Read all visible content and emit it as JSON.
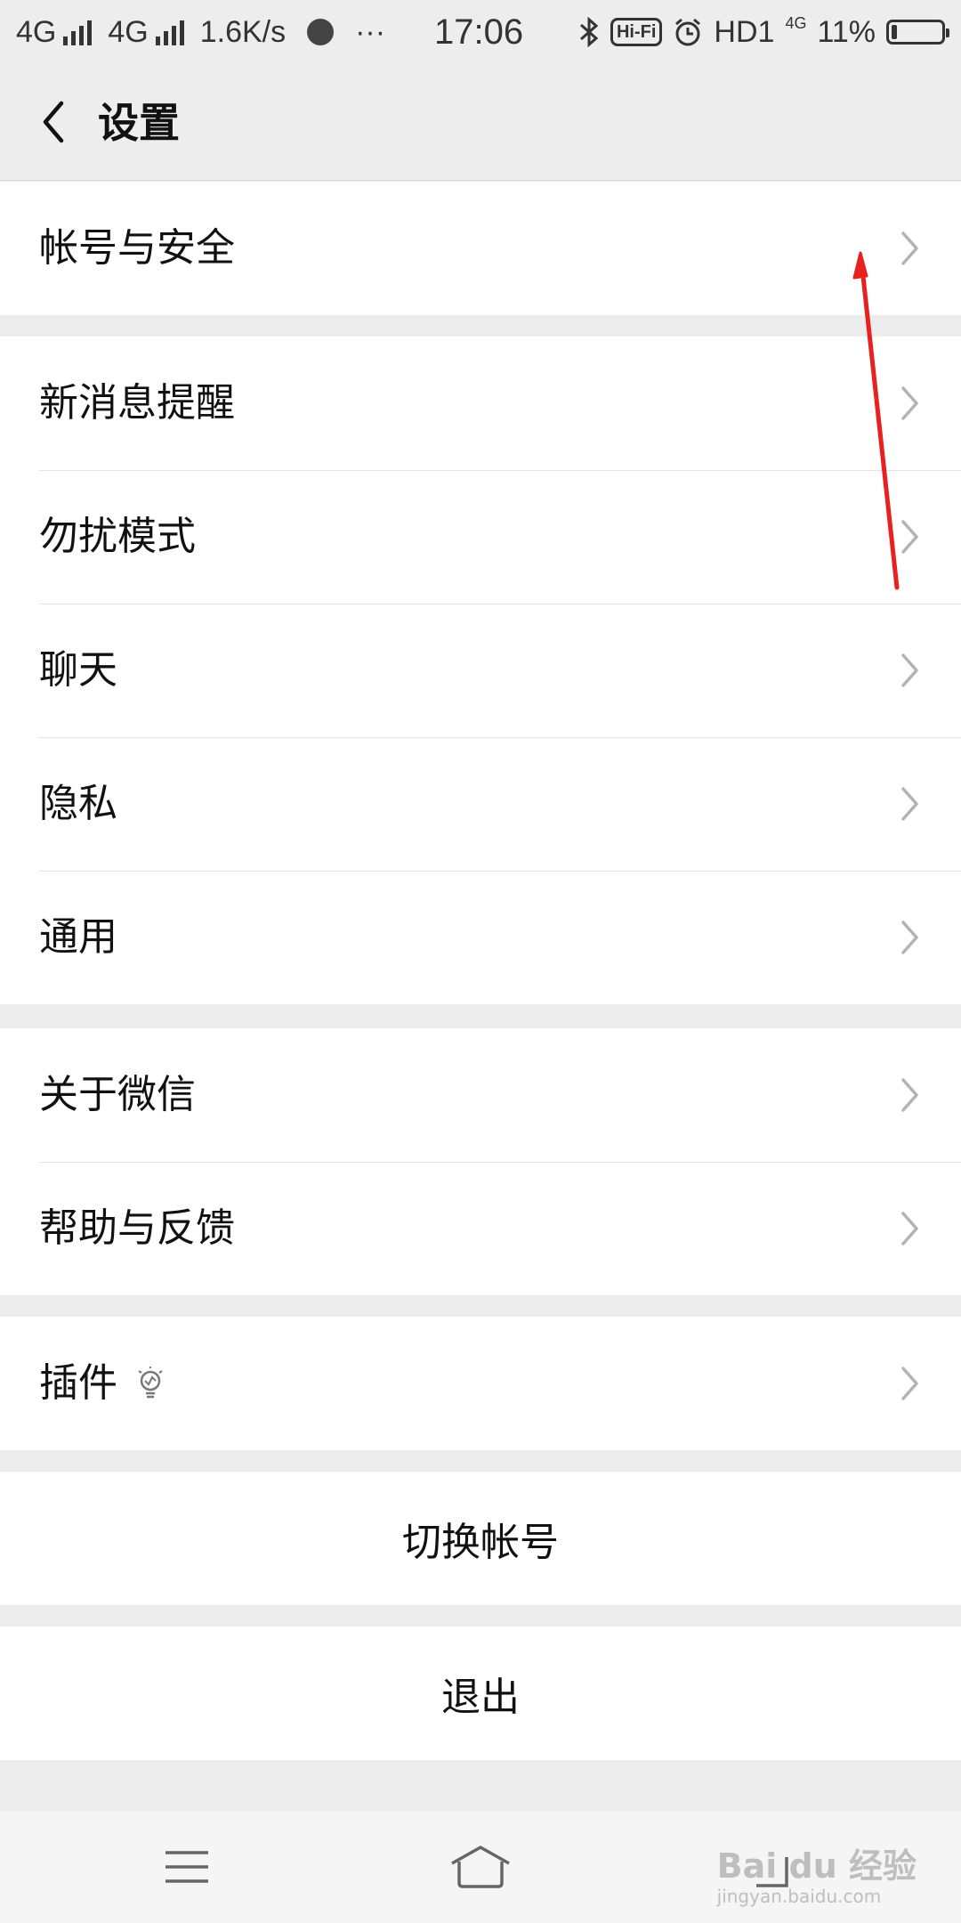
{
  "status_bar": {
    "network1": "4G",
    "network2": "4G",
    "speed": "1.6K/s",
    "more": "···",
    "time": "17:06",
    "hifi": "Hi-Fi",
    "hd": "HD1",
    "small_net": "4G",
    "battery_percent": "11%",
    "battery_level": 0.11
  },
  "header": {
    "title": "设置"
  },
  "groups": [
    {
      "items": [
        {
          "label": "帐号与安全"
        }
      ]
    },
    {
      "items": [
        {
          "label": "新消息提醒"
        },
        {
          "label": "勿扰模式"
        },
        {
          "label": "聊天"
        },
        {
          "label": "隐私"
        },
        {
          "label": "通用"
        }
      ]
    },
    {
      "items": [
        {
          "label": "关于微信"
        },
        {
          "label": "帮助与反馈"
        }
      ]
    },
    {
      "items": [
        {
          "label": "插件"
        }
      ]
    }
  ],
  "actions": {
    "switch_account": "切换帐号",
    "logout": "退出"
  },
  "watermark": {
    "brand": "Bai du 经验",
    "url": "jingyan.baidu.com"
  },
  "colors": {
    "annotation": "#e8201e",
    "background": "#ededed"
  },
  "icons": [
    "back-arrow-icon",
    "chevron-right-icon",
    "lightbulb-icon",
    "menu-icon",
    "home-icon",
    "back-nav-icon",
    "bluetooth-icon",
    "alarm-icon",
    "battery-icon",
    "signal-icon"
  ]
}
